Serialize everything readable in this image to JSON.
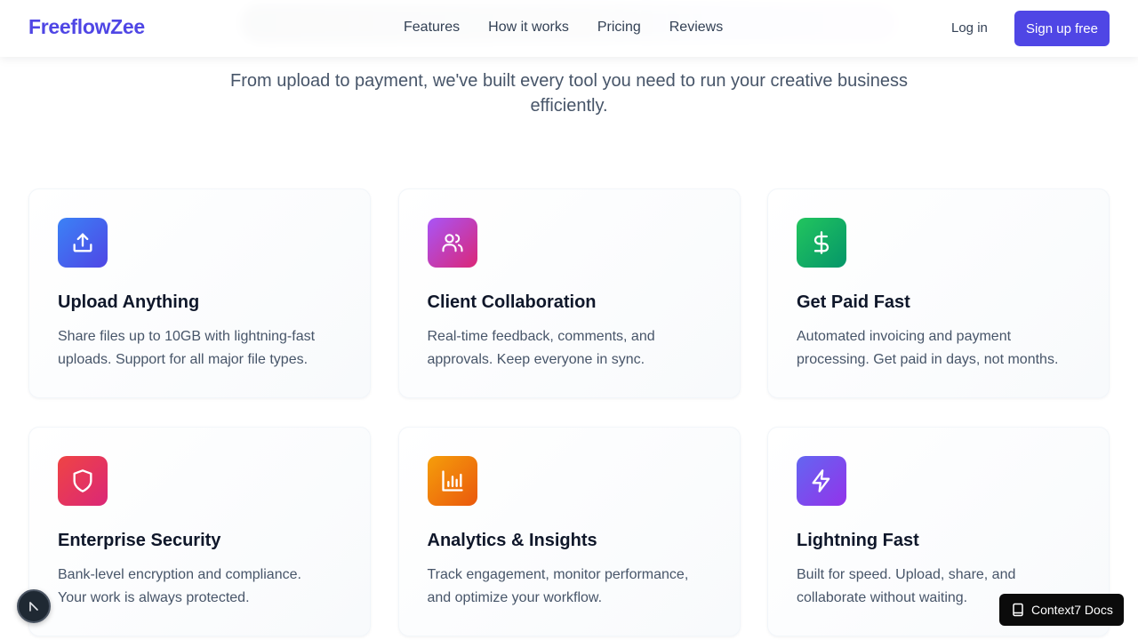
{
  "header": {
    "logo": "FreeflowZee",
    "nav": [
      "Features",
      "How it works",
      "Pricing",
      "Reviews"
    ],
    "login_label": "Log in",
    "signup_label": "Sign up free"
  },
  "section": {
    "subtitle": "From upload to payment, we've built every tool you need to run your creative business efficiently."
  },
  "features": [
    {
      "title": "Upload Anything",
      "description": "Share files up to 10GB with lightning-fast uploads. Support for all major file types.",
      "icon": "upload-icon"
    },
    {
      "title": "Client Collaboration",
      "description": "Real-time feedback, comments, and approvals. Keep everyone in sync.",
      "icon": "users-icon"
    },
    {
      "title": "Get Paid Fast",
      "description": "Automated invoicing and payment processing. Get paid in days, not months.",
      "icon": "dollar-icon"
    },
    {
      "title": "Enterprise Security",
      "description": "Bank-level encryption and compliance. Your work is always protected.",
      "icon": "shield-icon"
    },
    {
      "title": "Analytics & Insights",
      "description": "Track engagement, monitor performance, and optimize your workflow.",
      "icon": "chart-icon"
    },
    {
      "title": "Lightning Fast",
      "description": "Built for speed. Upload, share, and collaborate without waiting.",
      "icon": "lightning-icon"
    }
  ],
  "widgets": {
    "docs_label": "Context7 Docs"
  },
  "colors": {
    "brand": "#4f46e5",
    "text_dark": "#0f172a",
    "text_muted": "#475569"
  }
}
